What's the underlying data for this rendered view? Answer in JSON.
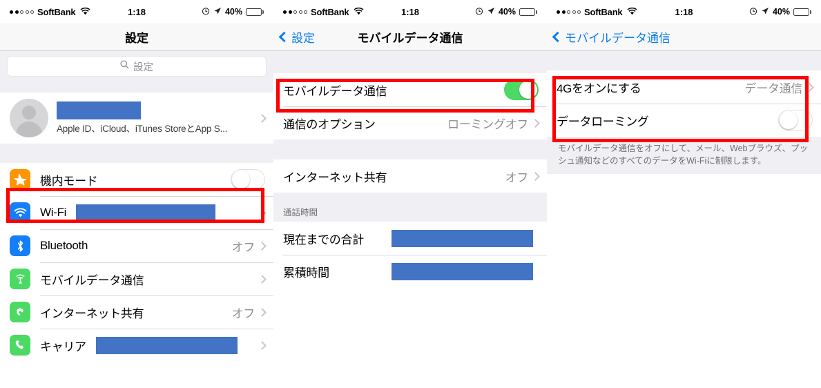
{
  "status_bar": {
    "carrier": "SoftBank",
    "signal_filled_dots": 2,
    "signal_empty_dots": 3,
    "wifi_icon": "wifi-icon",
    "time": "1:18",
    "alarm_icon": "alarm-clock-icon",
    "location_icon": "location-arrow-icon",
    "battery_percent": "40%",
    "battery_level": 40
  },
  "colors": {
    "highlight_red": "#ff0000",
    "redaction_blue": "#4273c4",
    "toggle_on_green": "#4cd964",
    "link_blue": "#0a7bf0",
    "group_bg": "#efeff4",
    "icon_orange": "#ff9500",
    "icon_blue": "#147efb",
    "icon_green": "#4cd964"
  },
  "screen1": {
    "nav_title": "設定",
    "search": {
      "placeholder": "設定",
      "icon": "search-icon"
    },
    "account": {
      "name_redacted": true,
      "subtitle": "Apple ID、iCloud、iTunes StoreとApp S...",
      "avatar_icon": "person-avatar-icon",
      "chevron": "chevron-right-icon"
    },
    "rows": [
      {
        "label": "機内モード",
        "icon": "airplane-icon",
        "icon_class": "ic-airplane",
        "control": "toggle",
        "toggle_state": "off",
        "highlighted": true
      },
      {
        "label": "Wi-Fi",
        "icon": "wifi-icon",
        "icon_class": "ic-wifi",
        "control": "chevron",
        "value_redacted": true
      },
      {
        "label": "Bluetooth",
        "icon": "bluetooth-icon",
        "icon_class": "ic-bt",
        "control": "chevron",
        "value": "オフ"
      },
      {
        "label": "モバイルデータ通信",
        "icon": "cellular-icon",
        "icon_class": "ic-cell",
        "control": "chevron",
        "value": ""
      },
      {
        "label": "インターネット共有",
        "icon": "personal-hotspot-icon",
        "icon_class": "ic-hotspot",
        "control": "chevron",
        "value": "オフ"
      },
      {
        "label": "キャリア",
        "icon": "phone-icon",
        "icon_class": "ic-carrier",
        "control": "chevron",
        "value_redacted": true
      }
    ]
  },
  "screen2": {
    "nav_back_label": "設定",
    "nav_title": "モバイルデータ通信",
    "group1": [
      {
        "label": "モバイルデータ通信",
        "control": "toggle",
        "toggle_state": "on",
        "highlighted": true
      },
      {
        "label": "通信のオプション",
        "control": "chevron",
        "value": "ローミングオフ"
      }
    ],
    "group2": [
      {
        "label": "インターネット共有",
        "control": "chevron",
        "value": "オフ"
      }
    ],
    "section_header": "通話時間",
    "group3": [
      {
        "label": "現在までの合計",
        "value_redacted": true
      },
      {
        "label": "累積時間",
        "value_redacted": true
      }
    ]
  },
  "screen3": {
    "nav_back_label": "モバイルデータ通信",
    "group1": [
      {
        "label": "4Gをオンにする",
        "control": "chevron",
        "value": "データ通信"
      },
      {
        "label": "データローミング",
        "control": "toggle",
        "toggle_state": "off"
      }
    ],
    "highlighted": true,
    "footnote": "モバイルデータ通信をオフにして、メール、Webブラウズ、プッシュ通知などのすべてのデータをWi-Fiに制限します。"
  }
}
